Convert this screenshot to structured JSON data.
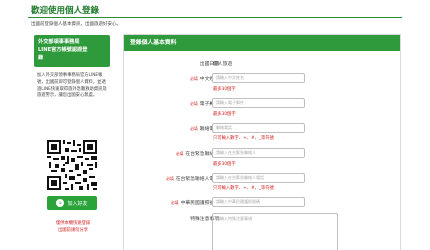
{
  "page": {
    "title": "歡迎使用個人登錄",
    "notice": "出國前登錄個人基本資訊，出國旅遊好安心。"
  },
  "sidebar": {
    "promo_lines": [
      "外交部領事事務局",
      "LINE官方帳號認證登",
      "錄"
    ],
    "description": "加入外交部領事事務局官方LINE帳號，出國前即可登錄個人資料，並透過LINE快速取得旅外急難救助資訊及旅遊警示，讓您出國安心無虞。",
    "friend_button": "加入好友",
    "warning_lines": [
      "僅供本機快速登錄",
      "出國前請勿分享"
    ]
  },
  "form": {
    "header": "登錄個人基本資料",
    "required_mark": "必填",
    "rows": [
      {
        "label": "出國日期",
        "value": "個人旅遊"
      },
      {
        "label": "中文姓名",
        "placeholder": "請輸入中文姓名",
        "hint": "最多30個字"
      },
      {
        "label": "電子郵件",
        "placeholder": "請輸入電子郵件",
        "hint": "最多30個字"
      },
      {
        "label": "聯絡電話",
        "placeholder": "聯絡電話",
        "hint": "只可輸入數字、+、#、_等符號"
      },
      {
        "label": "在台緊急聯絡人",
        "placeholder": "請輸入在台緊急聯絡人",
        "hint": "最多30個字"
      },
      {
        "label": "在台緊急聯絡人電話",
        "placeholder": "請輸入在台緊急聯絡人電話",
        "hint": "只可輸入數字、+、#、_等符號"
      },
      {
        "label": "中華民國護照號碼",
        "placeholder": "請輸入中華民國護照號碼"
      },
      {
        "label": "特殊注意事項",
        "placeholder": "請輸入特殊注意事項"
      }
    ]
  },
  "colors": {
    "brand_green": "#2e9a3c",
    "title_green": "#1e7a2c",
    "warning_red": "#d62020"
  }
}
